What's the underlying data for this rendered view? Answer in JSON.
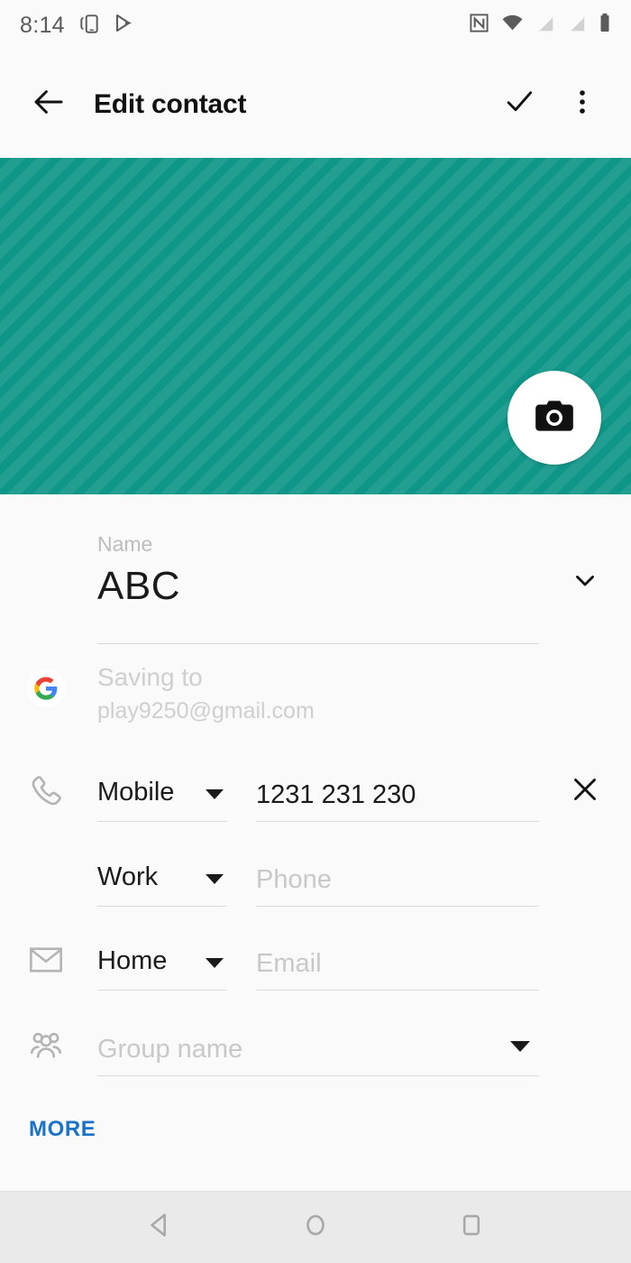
{
  "status_bar": {
    "time": "8:14",
    "left_icons": [
      "screen-mirror-icon",
      "play-store-icon"
    ],
    "right_icons": [
      "nfc-icon",
      "wifi-icon",
      "signal-no-sim-1-icon",
      "signal-no-sim-2-icon",
      "battery-icon"
    ]
  },
  "app_bar": {
    "back_label": "back-arrow-icon",
    "title": "Edit contact",
    "save_label": "check-icon",
    "overflow_label": "more-vert-icon"
  },
  "photo_header": {
    "background_color": "#0e9688",
    "camera_button_label": "camera-icon"
  },
  "form": {
    "name": {
      "label": "Name",
      "value": "ABC",
      "expand_icon": "chevron-down-icon"
    },
    "account": {
      "line1": "Saving to",
      "line2": "play9250@gmail.com",
      "icon": "google-logo-icon"
    },
    "phone_1": {
      "icon": "phone-icon",
      "type": "Mobile",
      "value": "1231 231 230",
      "placeholder": "Phone",
      "delete_icon": "close-icon"
    },
    "phone_2": {
      "type": "Work",
      "value": "",
      "placeholder": "Phone"
    },
    "email": {
      "icon": "email-icon",
      "type": "Home",
      "value": "",
      "placeholder": "Email"
    },
    "group": {
      "icon": "group-icon",
      "value": "",
      "placeholder": "Group name"
    },
    "more_label": "MORE",
    "more_color": "#1a73c8"
  },
  "nav_bar": {
    "back_label": "nav-back-icon",
    "home_label": "nav-home-icon",
    "recents_label": "nav-recents-icon"
  }
}
